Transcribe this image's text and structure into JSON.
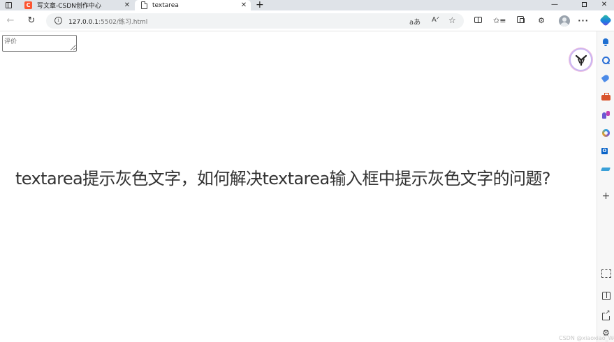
{
  "browser": {
    "tabs": [
      {
        "title": "写文章-CSDN创作中心",
        "favicon": "csdn-c-logo",
        "active": false
      },
      {
        "title": "textarea",
        "favicon": "document-icon",
        "active": true
      }
    ],
    "tab_close_glyph": "✕",
    "new_tab_glyph": "+",
    "url_host": "127.0.0.1",
    "url_rest": ":5502/练习.html",
    "window_controls": {
      "minimize": "—",
      "close": "✕"
    },
    "toolbar_glyphs": {
      "back": "←",
      "reload": "↻",
      "read_aloud": "aあ",
      "translate": "Aᐟ",
      "favorite": "☆",
      "favorites": "✩≡",
      "extensions": "⚙",
      "more": "···"
    }
  },
  "sidebar": {
    "add_glyph": "+",
    "settings_glyph": "⚙"
  },
  "page": {
    "textarea_placeholder": "评价"
  },
  "overlay": {
    "title": "textarea提示灰色文字，如何解决textarea输入框中提示灰色文字的问题?",
    "watermark": "CSDN @xiaoxiao_Wei"
  },
  "colors": {
    "tabstrip": "#dfe3e8",
    "csdn_brand": "#fc5531",
    "overlay_text": "#333333"
  }
}
